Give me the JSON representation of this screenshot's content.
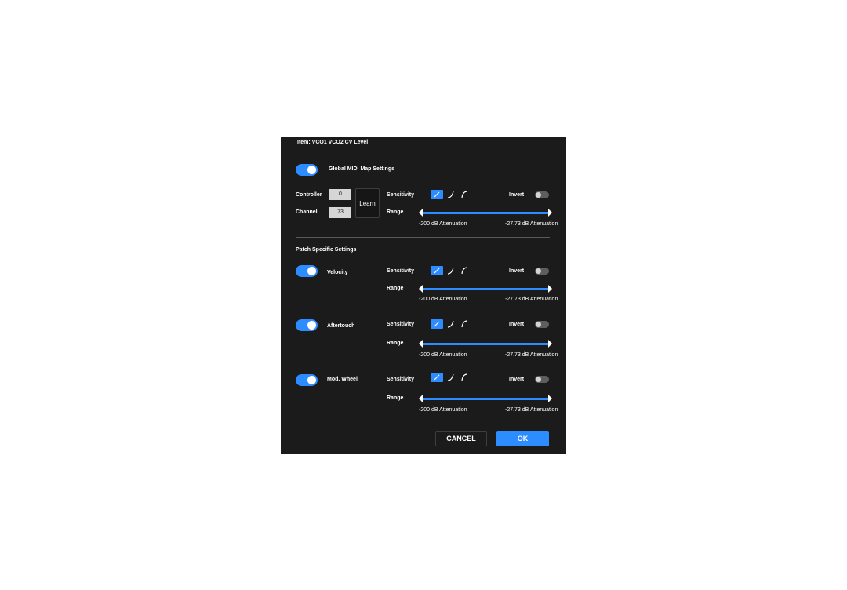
{
  "dialog": {
    "title": "Item: VCO1 VCO2 CV Level",
    "cancel_label": "CANCEL",
    "ok_label": "OK"
  },
  "global": {
    "label": "Global MIDI Map Settings",
    "enabled": true,
    "controller_label": "Controller",
    "controller_value": "0",
    "channel_label": "Channel",
    "channel_value": "73",
    "learn_label": "Learn",
    "sensitivity_label": "Sensitivity",
    "sensitivity_selected": "linear-curve",
    "invert_label": "Invert",
    "invert_on": false,
    "range_label": "Range",
    "range_min": "-200 dB Attenuation",
    "range_max": "-27.73 dB Attenuation"
  },
  "patch": {
    "heading": "Patch Specific Settings",
    "rows": [
      {
        "label": "Velocity",
        "enabled": true,
        "sensitivity_label": "Sensitivity",
        "sensitivity_selected": "linear-curve",
        "invert_label": "Invert",
        "invert_on": false,
        "range_label": "Range",
        "range_min": "-200 dB Attenuation",
        "range_max": "-27.73 dB Attenuation"
      },
      {
        "label": "Aftertouch",
        "enabled": true,
        "sensitivity_label": "Sensitivity",
        "sensitivity_selected": "linear-curve",
        "invert_label": "Invert",
        "invert_on": false,
        "range_label": "Range",
        "range_min": "-200 dB Attenuation",
        "range_max": "-27.73 dB Attenuation"
      },
      {
        "label": "Mod. Wheel",
        "enabled": true,
        "sensitivity_label": "Sensitivity",
        "sensitivity_selected": "linear-curve",
        "invert_label": "Invert",
        "invert_on": false,
        "range_label": "Range",
        "range_min": "-200 dB Attenuation",
        "range_max": "-27.73 dB Attenuation"
      }
    ]
  },
  "colors": {
    "accent": "#2d8cff",
    "panel": "#1b1b1b",
    "divider": "#5a5a5a"
  },
  "icons": [
    "linear-curve-icon",
    "exponential-curve-icon",
    "logarithmic-curve-icon",
    "slider-thumb-icon"
  ]
}
